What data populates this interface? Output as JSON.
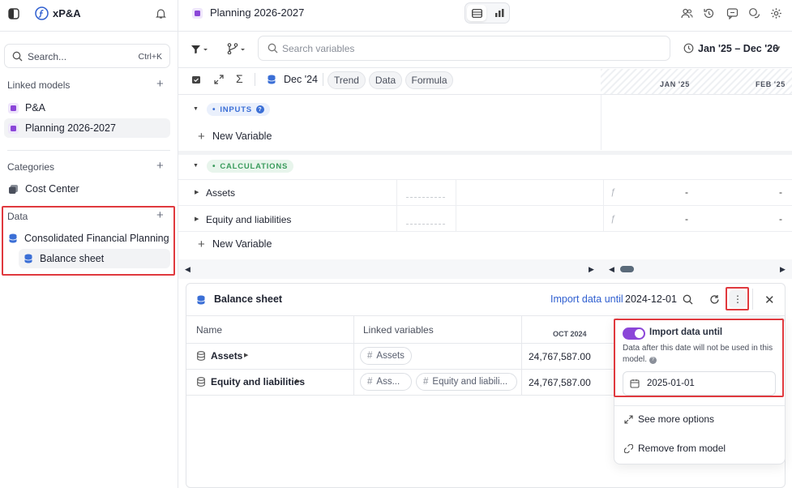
{
  "app": {
    "name": "xP&A"
  },
  "sidebar": {
    "search_placeholder": "Search...",
    "search_shortcut": "Ctrl+K",
    "linked_models_title": "Linked models",
    "linked_models": [
      {
        "label": "P&A"
      },
      {
        "label": "Planning 2026-2027",
        "selected": true
      }
    ],
    "categories_title": "Categories",
    "categories": [
      {
        "label": "Cost Center"
      }
    ],
    "data_title": "Data",
    "data_items": [
      {
        "label": "Consolidated Financial Planning"
      },
      {
        "label": "Balance sheet",
        "selected": true
      }
    ]
  },
  "header": {
    "title": "Planning 2026-2027",
    "date_range": "Jan '25 – Dec '26"
  },
  "toolbar": {
    "search_placeholder": "Search variables",
    "current_period": "Dec '24",
    "view_pills": [
      "Trend",
      "Data",
      "Formula"
    ],
    "columns": [
      "JAN '25",
      "FEB '25"
    ]
  },
  "grid": {
    "inputs_label": "INPUTS",
    "calculations_label": "CALCULATIONS",
    "new_variable_label": "New Variable",
    "rows": [
      {
        "name": "Assets",
        "jan": "-",
        "feb": "-"
      },
      {
        "name": "Equity and liabilities",
        "jan": "-",
        "feb": "-"
      }
    ]
  },
  "panel": {
    "title": "Balance sheet",
    "import_label": "Import data until",
    "import_date": "2024-12-01",
    "headers": {
      "name": "Name",
      "linked": "Linked variables",
      "month": "OCT 2024"
    },
    "rows": [
      {
        "name": "Assets",
        "chips": [
          "Assets"
        ],
        "value": "24,767,587.00"
      },
      {
        "name": "Equity and liabilities",
        "chips": [
          "Ass...",
          "Equity and liabili..."
        ],
        "value": "24,767,587.00"
      }
    ]
  },
  "popover": {
    "toggle_label": "Import data until",
    "toggle_on": true,
    "description": "Data after this date will not be used in this model.",
    "date_value": "2025-01-01",
    "see_more": "See more options",
    "remove": "Remove from model"
  },
  "colors": {
    "accent": "#8b46d8",
    "link": "#2f5fd0",
    "highlight": "#e0393e",
    "inputs_badge": "#3b6fd6",
    "calc_badge": "#3a9b5c"
  }
}
